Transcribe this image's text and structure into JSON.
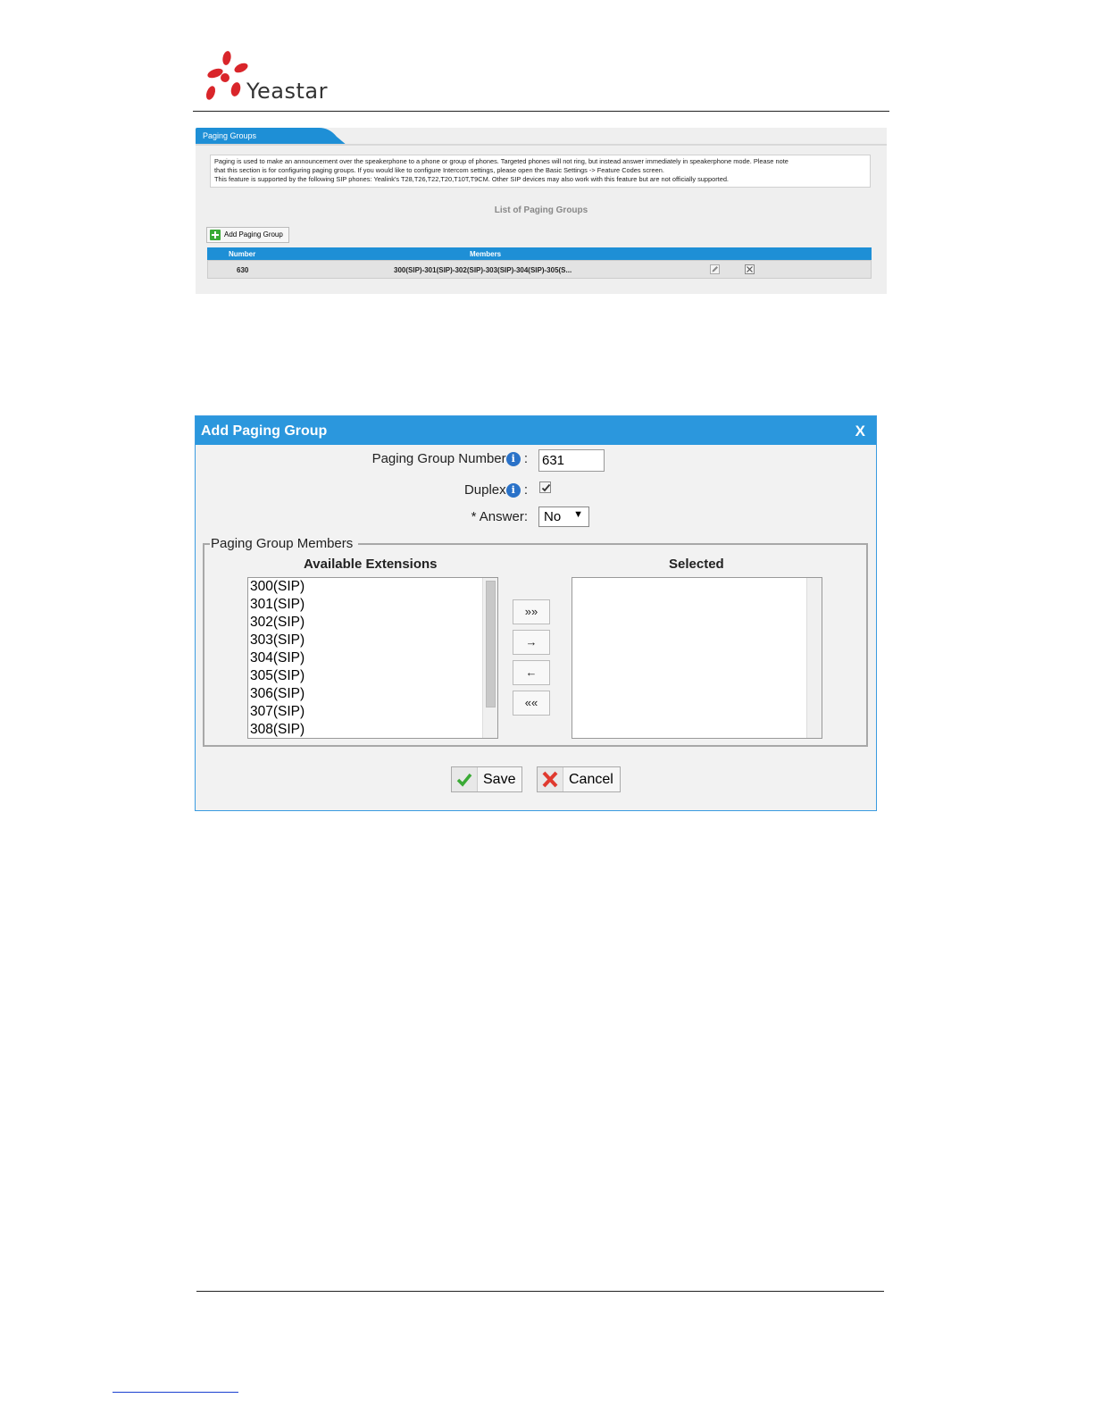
{
  "brand": {
    "name": "Yeastar"
  },
  "paging_panel": {
    "tab_title": "Paging Groups",
    "description_lines": [
      "Paging is used to make an announcement over the speakerphone to a phone or group of phones. Targeted phones will not ring, but instead answer immediately in speakerphone mode. Please note",
      "that this section is for configuring paging groups. If you would like to configure Intercom settings, please open the Basic Settings -> Feature Codes screen.",
      "This feature is supported by the following SIP phones: Yealink's T28,T26,T22,T20,T10T,T9CM. Other SIP devices may also work with this feature but are not officially supported."
    ],
    "list_title": "List of Paging Groups",
    "add_button_label": "Add Paging Group",
    "columns": {
      "number": "Number",
      "members": "Members"
    },
    "rows": [
      {
        "number": "630",
        "members": "300(SIP)-301(SIP)-302(SIP)-303(SIP)-304(SIP)-305(S..."
      }
    ]
  },
  "dialog": {
    "title": "Add Paging Group",
    "close_label": "X",
    "fields": {
      "number_label": "Paging Group Number",
      "number_value": "631",
      "duplex_label": "Duplex",
      "duplex_checked": true,
      "answer_label": "* Answer:",
      "answer_value": "No",
      "colon": ":"
    },
    "members": {
      "legend": "Paging Group Members",
      "available_title": "Available Extensions",
      "selected_title": "Selected",
      "available": [
        "300(SIP)",
        "301(SIP)",
        "302(SIP)",
        "303(SIP)",
        "304(SIP)",
        "305(SIP)",
        "306(SIP)",
        "307(SIP)",
        "308(SIP)"
      ],
      "selected": [],
      "move_buttons": {
        "add_all": "»»",
        "add": "→",
        "remove": "←",
        "remove_all": "««"
      }
    },
    "buttons": {
      "save": "Save",
      "cancel": "Cancel"
    }
  },
  "colors": {
    "accent_blue": "#2b97dd",
    "header_blue": "#1e8fd6",
    "logo_red": "#d9252a"
  }
}
